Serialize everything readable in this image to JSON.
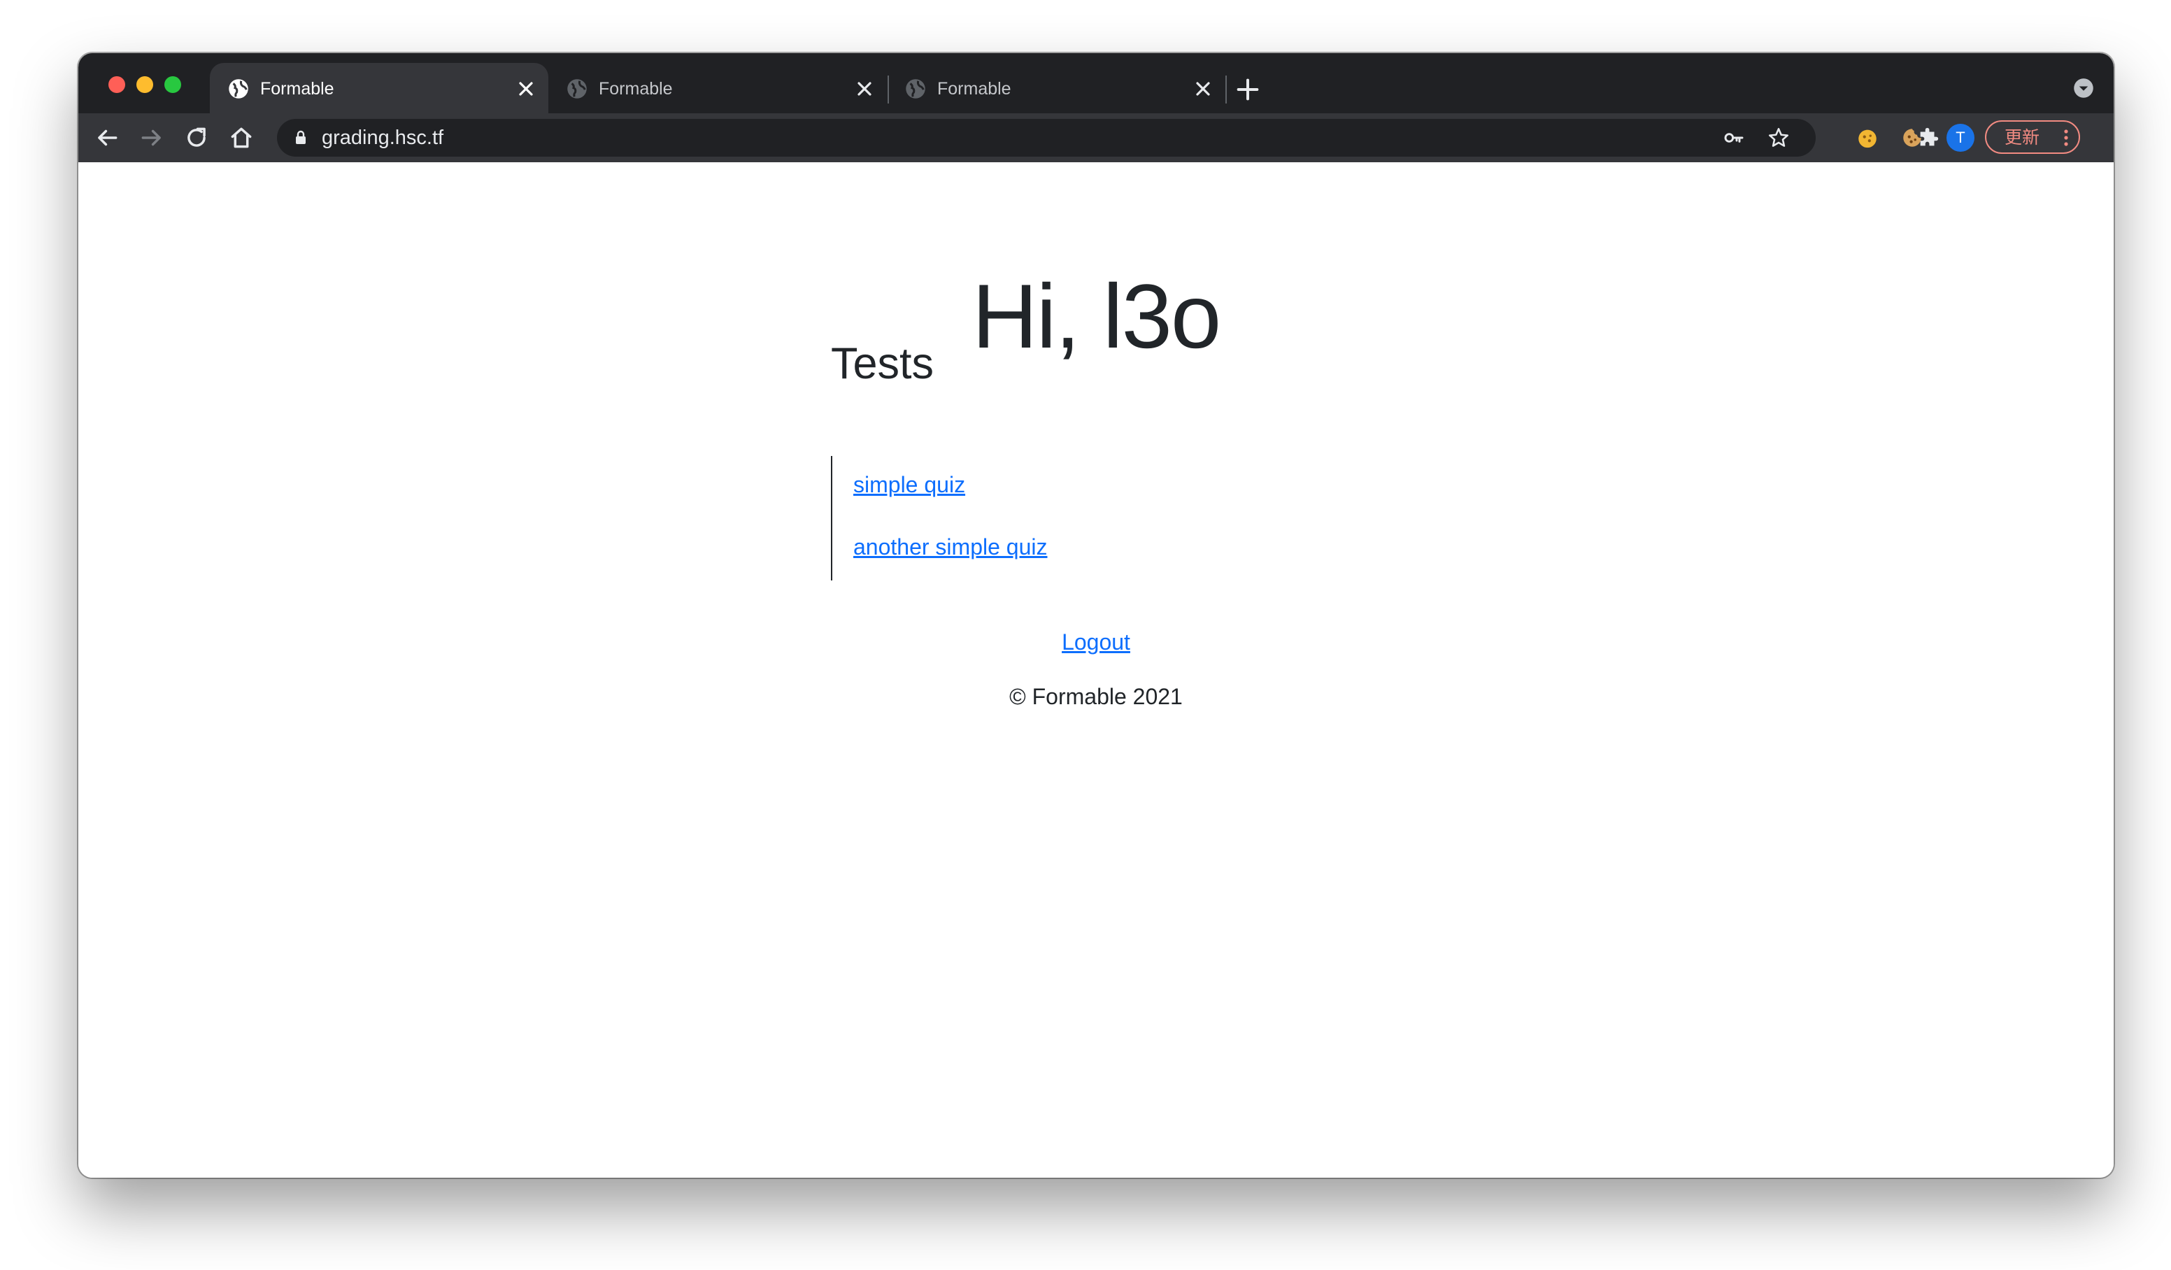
{
  "browser": {
    "tabs": [
      {
        "title": "Formable",
        "active": true
      },
      {
        "title": "Formable",
        "active": false
      },
      {
        "title": "Formable",
        "active": false
      }
    ],
    "url": "grading.hsc.tf",
    "profile_initial": "T",
    "update_label": "更新",
    "icons": {
      "favicon": "globe-icon",
      "close": "close-icon",
      "new_tab": "plus-icon",
      "tab_search": "chevron-down-circle-icon",
      "back": "back-arrow-icon",
      "forward": "forward-arrow-icon",
      "reload": "reload-icon",
      "home": "home-icon",
      "lock": "lock-icon",
      "key": "key-icon",
      "bookmark": "star-icon",
      "extensions": [
        "cookie-icon",
        "cookie-bite-icon",
        "puzzle-icon"
      ],
      "menu": "kebab-menu-icon"
    },
    "colors": {
      "frame": "#202124",
      "toolbar": "#35363a",
      "profile": "#1a73e8",
      "update_accent": "#f28b82"
    }
  },
  "page": {
    "greeting": "Hi, l3o",
    "tests_heading": "Tests",
    "tests": [
      {
        "label": "simple quiz"
      },
      {
        "label": "another simple quiz"
      }
    ],
    "logout_label": "Logout",
    "footer": "© Formable 2021",
    "colors": {
      "text": "#212529",
      "link": "#0d6efd"
    }
  }
}
